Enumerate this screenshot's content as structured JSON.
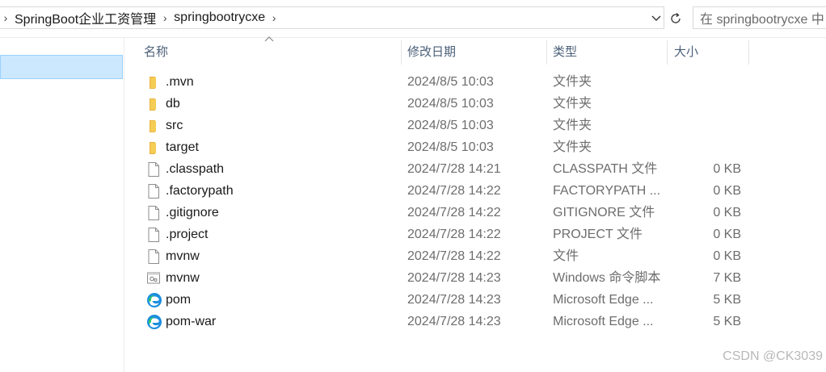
{
  "address": {
    "breadcrumbs": [
      "SpringBoot企业工资管理",
      "springbootrycxe"
    ],
    "search_placeholder": "在 springbootrycxe 中"
  },
  "columns": {
    "name": "名称",
    "date": "修改日期",
    "type": "类型",
    "size": "大小"
  },
  "files": [
    {
      "name": ".mvn",
      "date": "2024/8/5 10:03",
      "type": "文件夹",
      "size": "",
      "icon": "folder-icon"
    },
    {
      "name": "db",
      "date": "2024/8/5 10:03",
      "type": "文件夹",
      "size": "",
      "icon": "folder-icon"
    },
    {
      "name": "src",
      "date": "2024/8/5 10:03",
      "type": "文件夹",
      "size": "",
      "icon": "folder-icon"
    },
    {
      "name": "target",
      "date": "2024/8/5 10:03",
      "type": "文件夹",
      "size": "",
      "icon": "folder-icon"
    },
    {
      "name": ".classpath",
      "date": "2024/7/28 14:21",
      "type": "CLASSPATH 文件",
      "size": "0 KB",
      "icon": "file-icon"
    },
    {
      "name": ".factorypath",
      "date": "2024/7/28 14:22",
      "type": "FACTORYPATH ...",
      "size": "0 KB",
      "icon": "file-icon"
    },
    {
      "name": ".gitignore",
      "date": "2024/7/28 14:22",
      "type": "GITIGNORE 文件",
      "size": "0 KB",
      "icon": "file-icon"
    },
    {
      "name": ".project",
      "date": "2024/7/28 14:22",
      "type": "PROJECT 文件",
      "size": "0 KB",
      "icon": "file-icon"
    },
    {
      "name": "mvnw",
      "date": "2024/7/28 14:22",
      "type": "文件",
      "size": "0 KB",
      "icon": "file-icon"
    },
    {
      "name": "mvnw",
      "date": "2024/7/28 14:23",
      "type": "Windows 命令脚本",
      "size": "7 KB",
      "icon": "script-icon"
    },
    {
      "name": "pom",
      "date": "2024/7/28 14:23",
      "type": "Microsoft Edge ...",
      "size": "5 KB",
      "icon": "edge-icon"
    },
    {
      "name": "pom-war",
      "date": "2024/7/28 14:23",
      "type": "Microsoft Edge ...",
      "size": "5 KB",
      "icon": "edge-icon"
    }
  ],
  "watermark": "CSDN @CK3039",
  "colors": {
    "selection": "#cce8ff",
    "folder": "#f2c94c",
    "header_text": "#4c607a"
  }
}
